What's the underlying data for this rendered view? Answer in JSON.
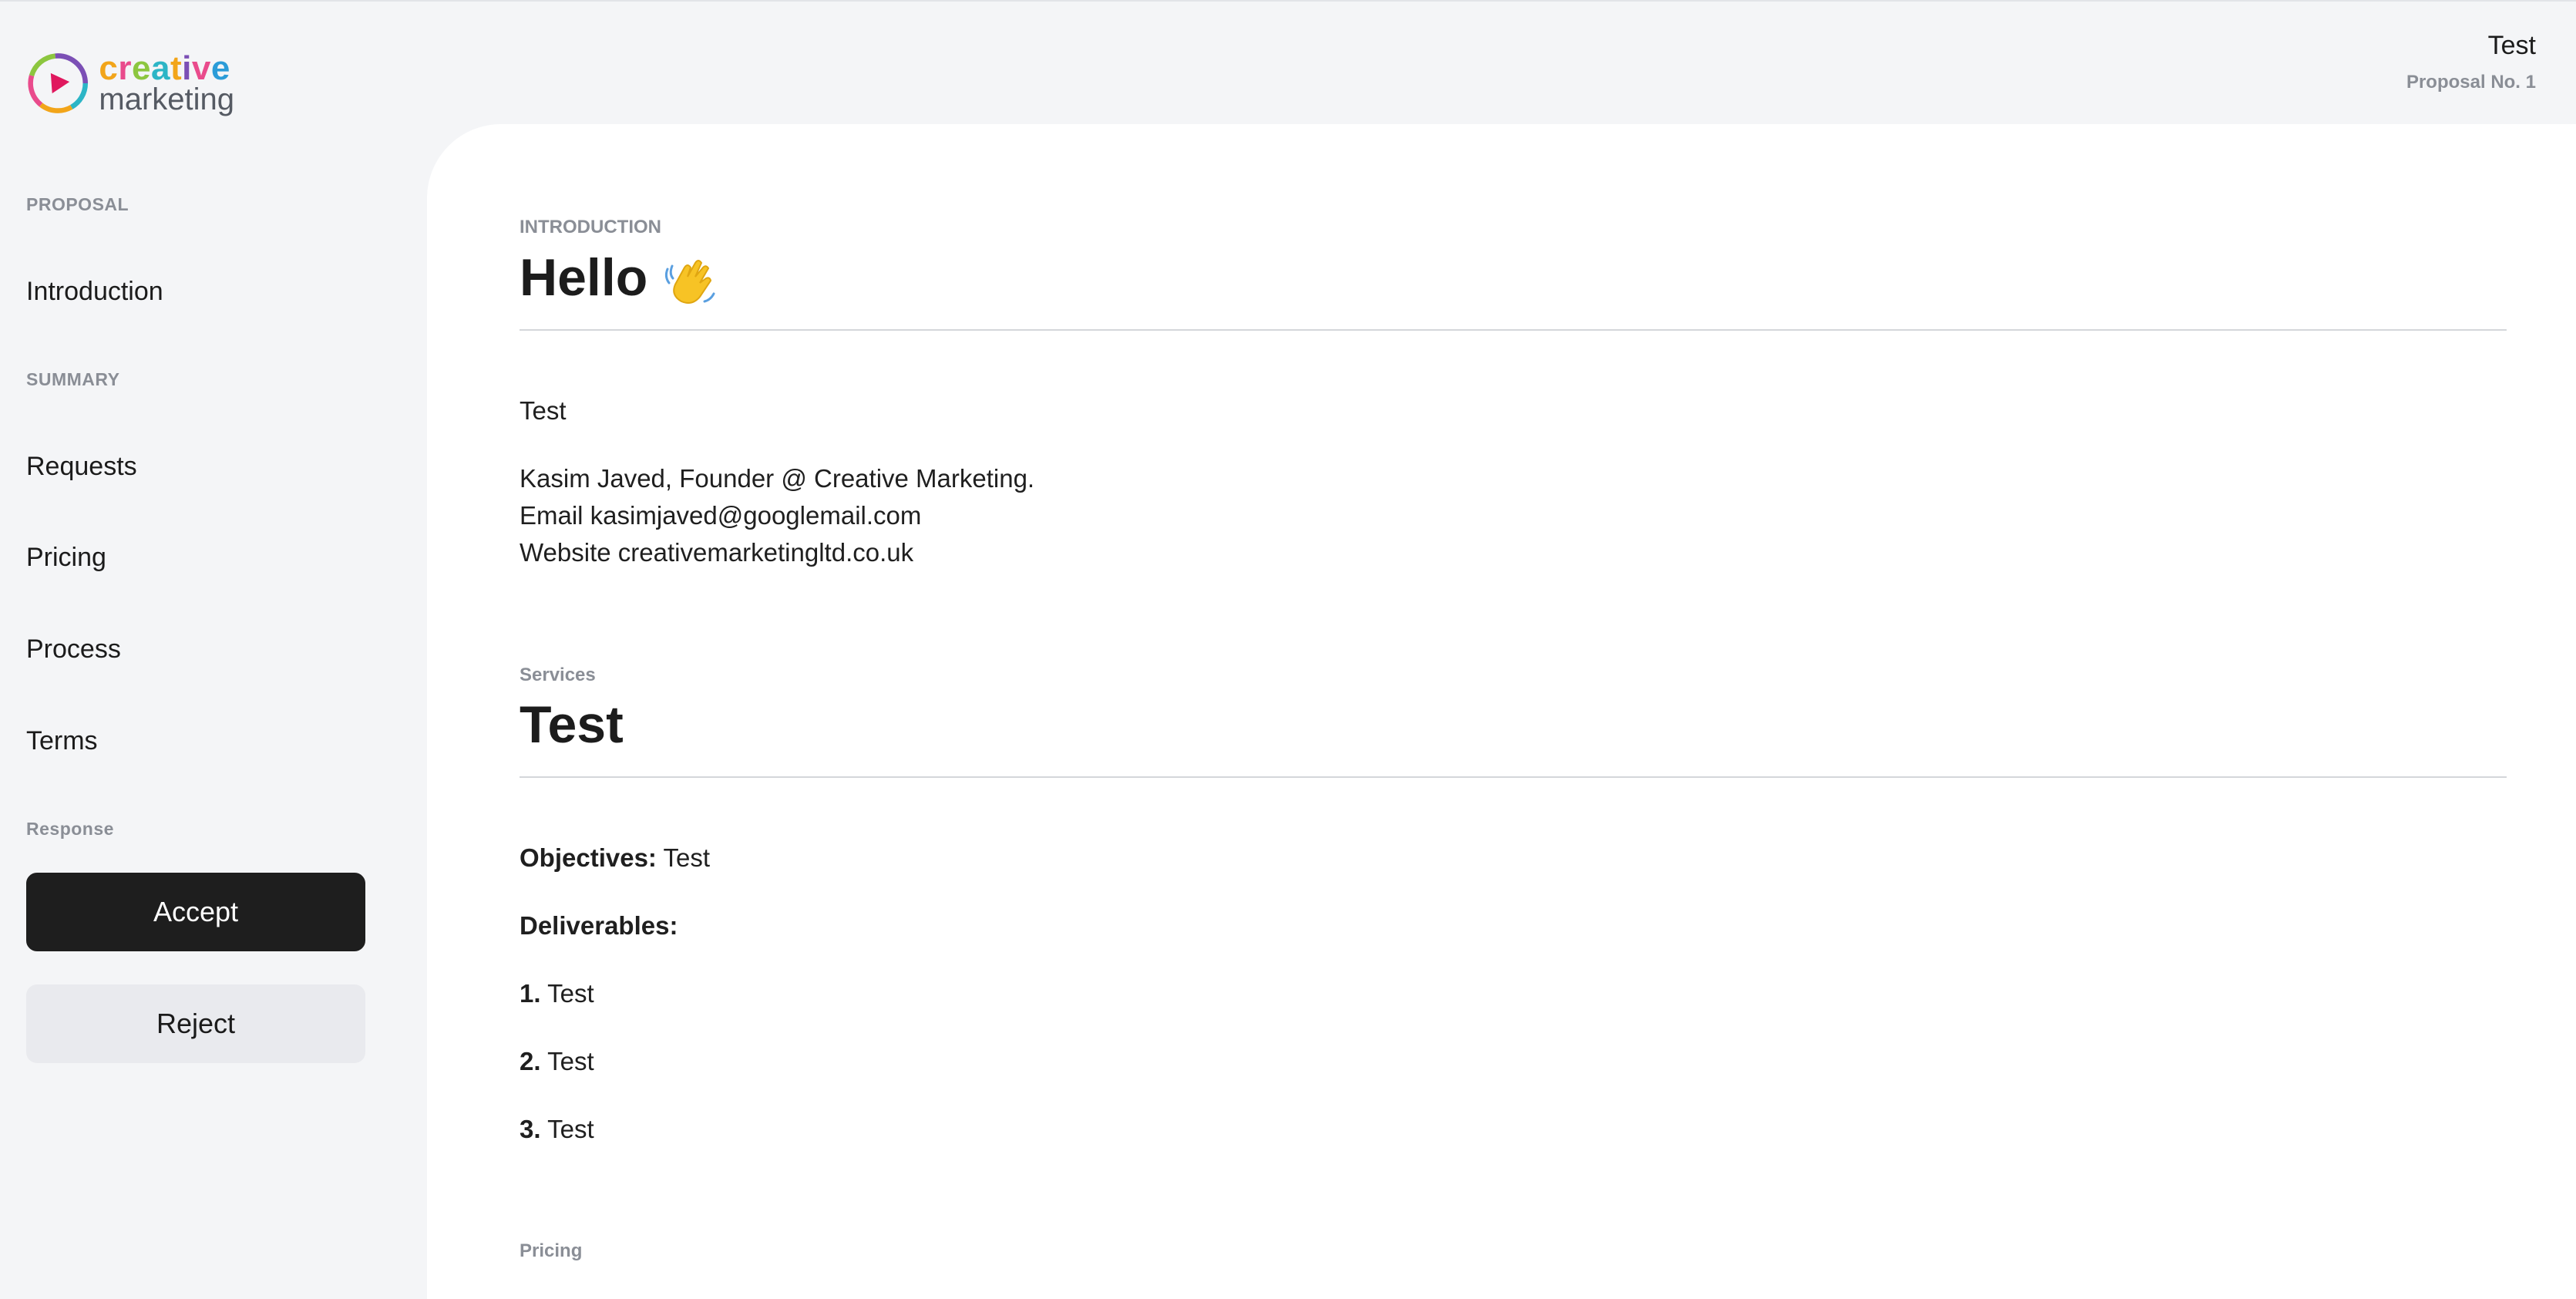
{
  "brand": {
    "name_top": "creative",
    "name_bottom": "marketing",
    "logo_icon": "play-circle-logo-icon"
  },
  "header": {
    "title": "Test",
    "proposal_number": "Proposal No. 1"
  },
  "sidebar": {
    "proposal_label": "PROPOSAL",
    "introduction": "Introduction",
    "summary_label": "SUMMARY",
    "requests": "Requests",
    "pricing": "Pricing",
    "process": "Process",
    "terms": "Terms",
    "response_label": "Response",
    "accept_label": "Accept",
    "reject_label": "Reject"
  },
  "intro": {
    "eyebrow": "INTRODUCTION",
    "heading": "Hello",
    "heading_icon": "waving-hand-icon",
    "body": "Test",
    "signature": "Kasim Javed, Founder @ Creative Marketing.",
    "email_line": "Email kasimjaved@googlemail.com",
    "website_line": "Website creativemarketingltd.co.uk"
  },
  "services": {
    "eyebrow": "Services",
    "heading": "Test",
    "objectives_label": "Objectives:",
    "objectives_value": "Test",
    "deliverables_label": "Deliverables:",
    "deliverables": [
      {
        "num": "1.",
        "text": "Test"
      },
      {
        "num": "2.",
        "text": "Test"
      },
      {
        "num": "3.",
        "text": "Test"
      }
    ]
  },
  "pricing_section": {
    "eyebrow": "Pricing"
  },
  "colors": {
    "background": "#f4f5f7",
    "panel": "#ffffff",
    "accept_bg": "#1e1e1e",
    "reject_bg": "#e9eaee"
  }
}
